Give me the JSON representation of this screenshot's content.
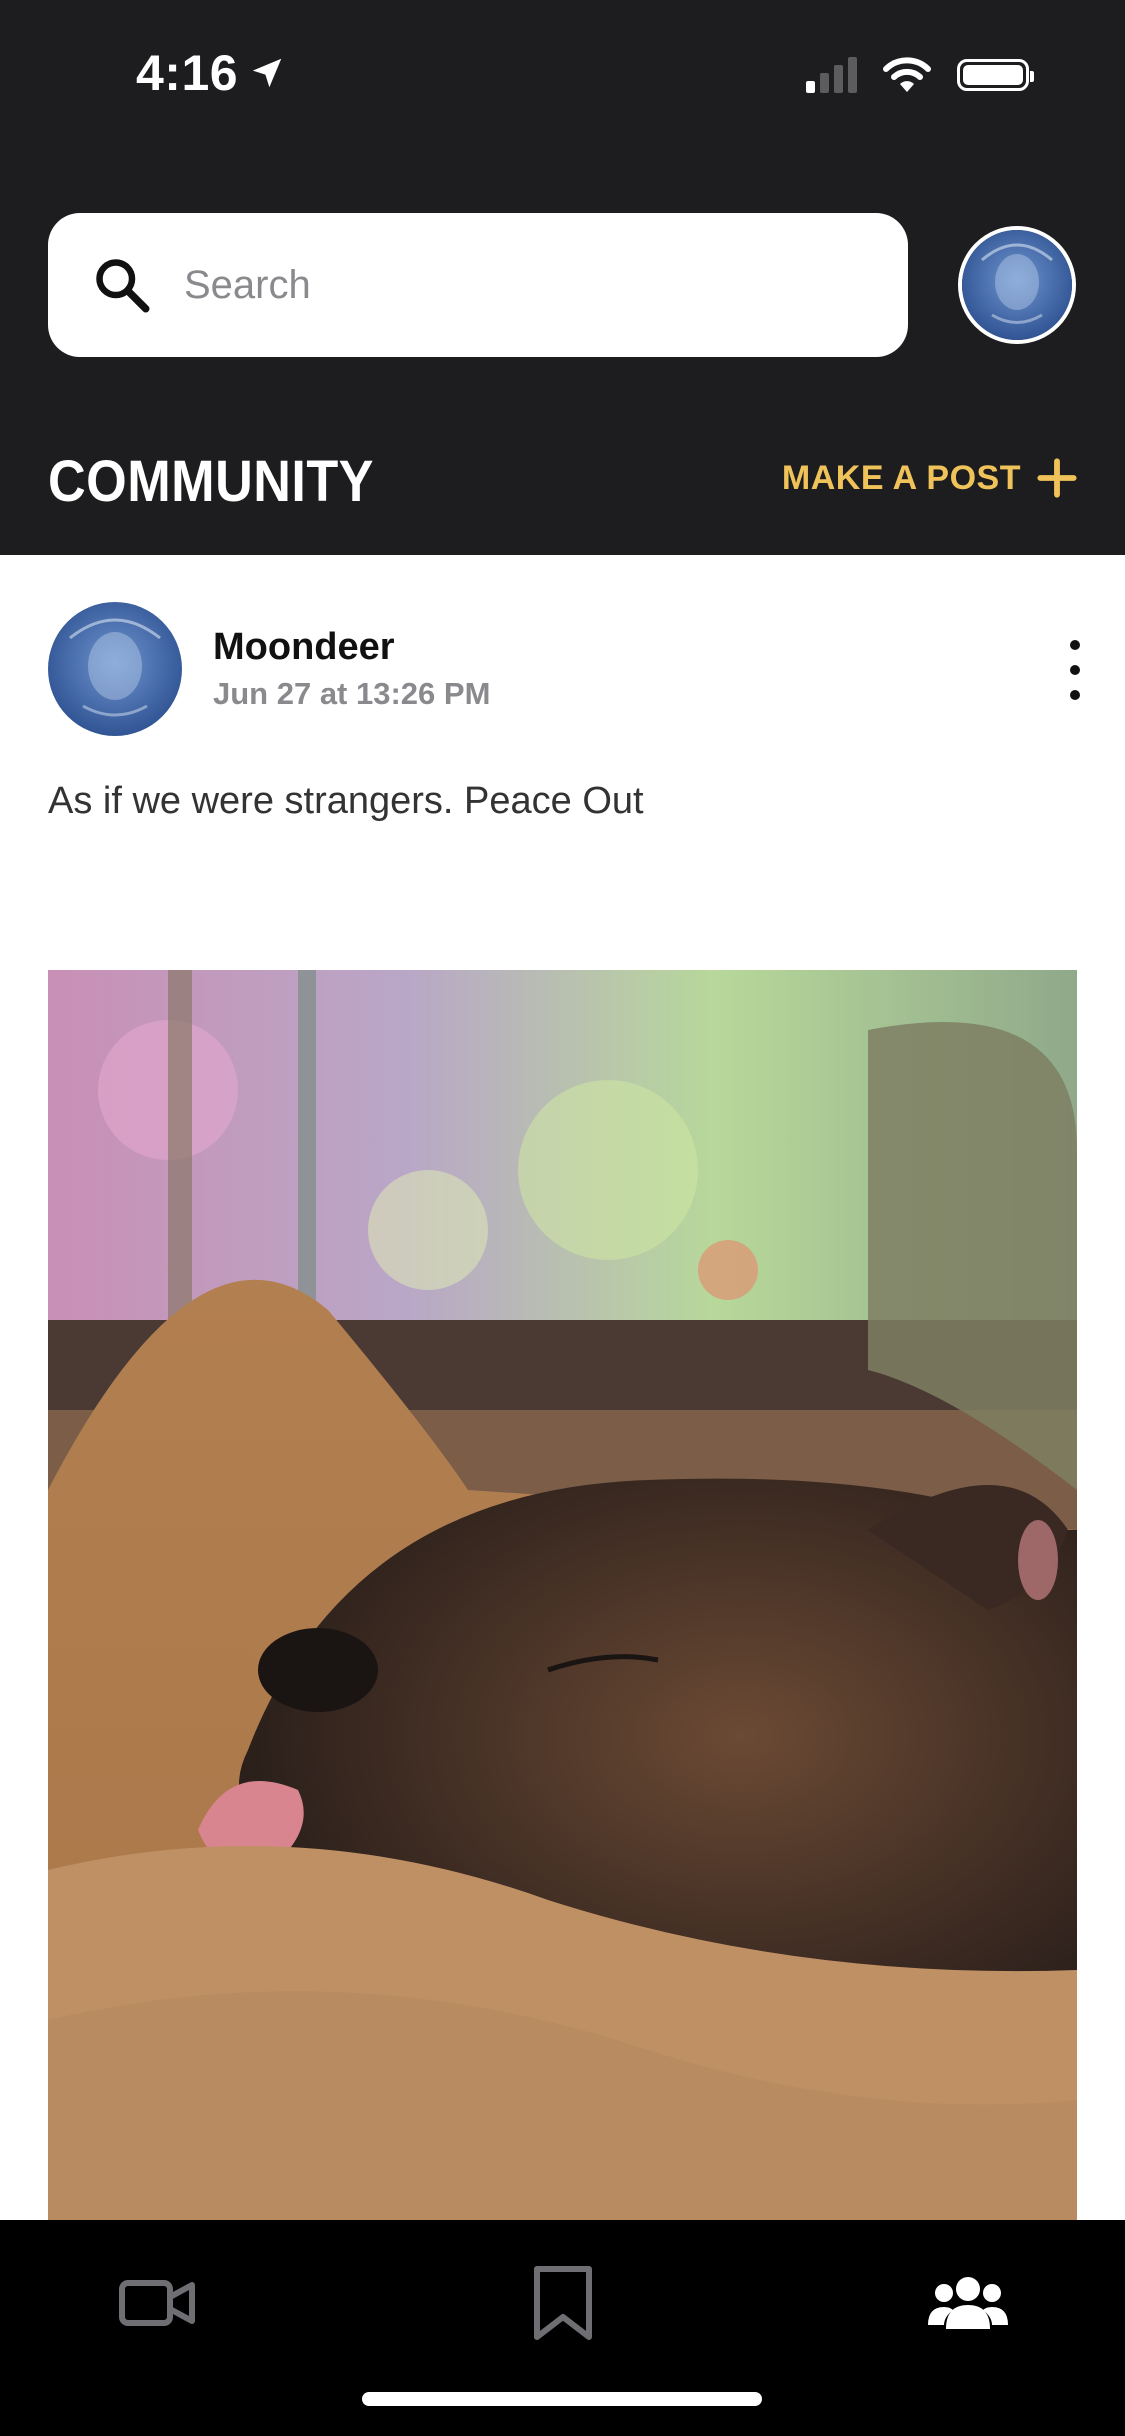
{
  "status_bar": {
    "time": "4:16",
    "location_icon": "location-arrow-icon",
    "signal_bars_on": 1,
    "signal_bars_total": 4,
    "wifi_icon": "wifi-icon",
    "battery_icon": "battery-full-icon"
  },
  "header": {
    "search": {
      "placeholder": "Search",
      "value": "",
      "icon": "search-icon"
    },
    "profile_avatar": "profile-avatar",
    "section_title": "COMMUNITY",
    "make_post_label": "MAKE A POST",
    "make_post_icon": "plus-icon",
    "accent_color": "#f0c35a",
    "background_color": "#1d1d1f"
  },
  "post": {
    "author": "Moondeer",
    "timestamp": "Jun 27 at 13:26 PM",
    "text": "As if we were strangers. Peace Out",
    "more_icon": "more-vertical-icon",
    "image": "sleeping-brindle-dog-on-fleece-blanket"
  },
  "tabbar": {
    "tabs": [
      {
        "name": "videos",
        "icon": "video-camera-icon",
        "active": false
      },
      {
        "name": "saved",
        "icon": "bookmark-icon",
        "active": false
      },
      {
        "name": "community",
        "icon": "users-icon",
        "active": true
      }
    ]
  }
}
